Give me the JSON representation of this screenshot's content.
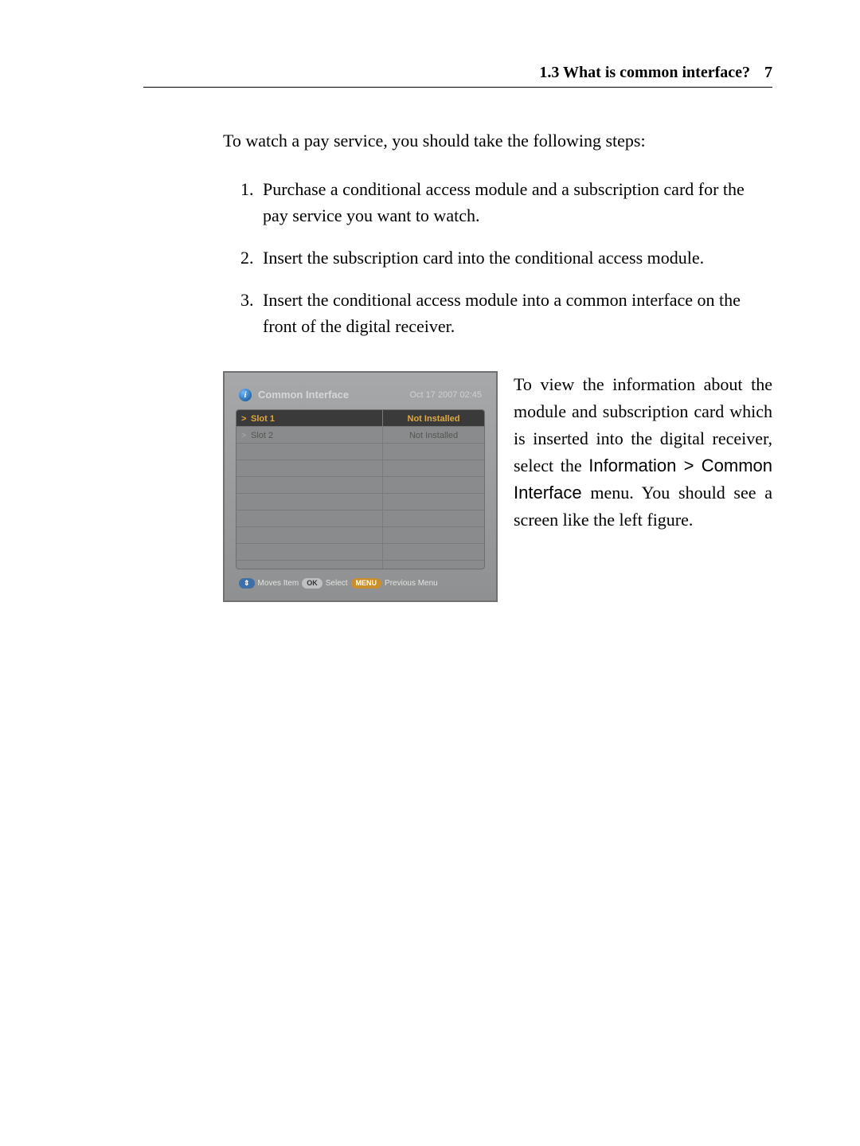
{
  "header": {
    "section": "1.3 What is common interface?",
    "page_number": "7"
  },
  "intro": "To watch a pay service, you should take the following steps:",
  "steps": [
    "Purchase a conditional access module and a subscription card for the pay service you want to watch.",
    "Insert the subscription card into the conditional access module.",
    "Insert the conditional access module into a common interface on the front of the digital receiver."
  ],
  "caption": {
    "pre": "To view the information about the module and subscription card which is inserted into the digital receiver, select the ",
    "menu_path": "Information > Common Interface",
    "post": " menu. You should see a screen like the left figure."
  },
  "screenshot": {
    "title": "Common Interface",
    "info_glyph": "i",
    "timestamp": "Oct 17 2007 02:45",
    "rows": [
      {
        "label": "Slot 1",
        "status": "Not Installed",
        "selected": true
      },
      {
        "label": "Slot 2",
        "status": "Not Installed",
        "selected": false
      }
    ],
    "blank_row_count": 8,
    "footer": {
      "key_nav": "⇕",
      "moves": "Moves Item",
      "key_ok": "OK",
      "select": "Select",
      "key_menu": "MENU",
      "prev": "Previous Menu"
    }
  }
}
